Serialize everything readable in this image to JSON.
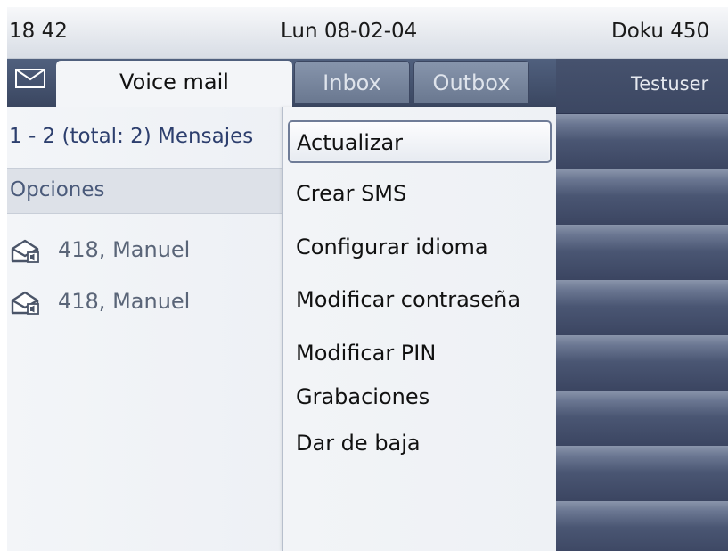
{
  "status_bar": {
    "time": "18 42",
    "date": "Lun 08-02-04",
    "device": "Doku 450"
  },
  "tabs": {
    "voicemail": "Voice mail",
    "inbox": "Inbox",
    "outbox": "Outbox"
  },
  "list": {
    "count_text": "1 - 2 (total: 2) Mensajes",
    "options_label": "Opciones",
    "messages": [
      {
        "name": "418, Manuel",
        "icon": "voicemail-envelope-icon"
      },
      {
        "name": "418, Manuel",
        "icon": "voicemail-envelope-icon"
      }
    ]
  },
  "right_panel": {
    "title": "Testuser"
  },
  "menu": {
    "items": [
      "Actualizar",
      "Crear SMS",
      "Configurar idioma",
      "Modificar contraseña",
      "Modificar PIN",
      "Grabaciones",
      "Dar de baja"
    ],
    "selected_index": 0
  },
  "colors": {
    "header_dark": "#3e4a66",
    "menu_focus_border": "#6f7c97",
    "count_text": "#2d3f6e"
  }
}
